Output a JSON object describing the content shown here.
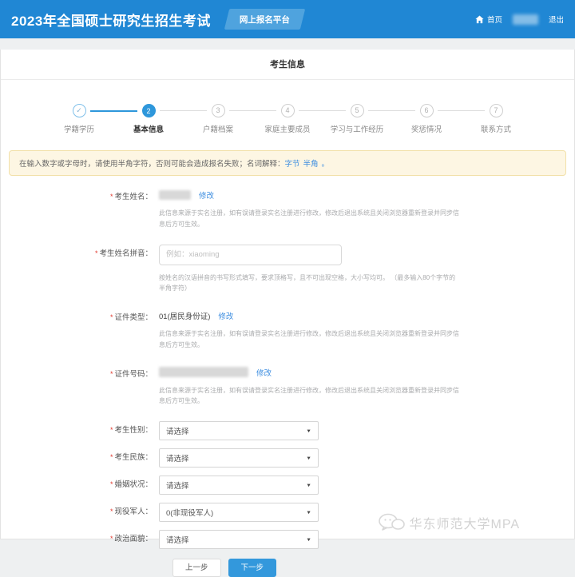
{
  "colors": {
    "header_blue": "#2087d4",
    "badge_blue": "#4fa3de",
    "accent_blue": "#2e97db",
    "link_blue": "#3e8ee0",
    "notice_bg": "#fdf6e3",
    "notice_border": "#f2e0a8",
    "required_red": "#e03a2f"
  },
  "header": {
    "title": "2023年全国硕士研究生招生考试",
    "badge": "网上报名平台",
    "home_label": "首页",
    "logout_label": "退出"
  },
  "page": {
    "title": "考生信息"
  },
  "steps": [
    {
      "num": "✓",
      "label": "学籍学历"
    },
    {
      "num": "2",
      "label": "基本信息"
    },
    {
      "num": "3",
      "label": "户籍档案"
    },
    {
      "num": "4",
      "label": "家庭主要成员"
    },
    {
      "num": "5",
      "label": "学习与工作经历"
    },
    {
      "num": "6",
      "label": "奖惩情况"
    },
    {
      "num": "7",
      "label": "联系方式"
    }
  ],
  "notice": {
    "prefix": "在输入数字或字母时，请使用半角字符，否则可能会造成报名失败；名词解释：",
    "link_byte": "字节",
    "link_halfwidth": "半角",
    "suffix": "。"
  },
  "form": {
    "required_mark": "*",
    "realname_help": "此信息来源于实名注册，如有误请登录实名注册进行修改，修改后退出系统且关闭浏览器重新登录并同步信息后方可生效。",
    "name": {
      "label": "考生姓名：",
      "edit": "修改"
    },
    "pinyin": {
      "label": "考生姓名拼音：",
      "value": "",
      "placeholder": "例如：xiaoming",
      "help": "按姓名的汉语拼音的书写形式填写，要求顶格写，且不可出现空格，大小写均可。 （最多输入80个字节的半角字符）"
    },
    "id_type": {
      "label": "证件类型：",
      "value": "01(居民身份证)",
      "edit": "修改"
    },
    "id_number": {
      "label": "证件号码：",
      "edit": "修改"
    },
    "gender": {
      "label": "考生性别：",
      "value": "请选择"
    },
    "ethnic": {
      "label": "考生民族：",
      "value": "请选择"
    },
    "marital": {
      "label": "婚姻状况：",
      "value": "请选择"
    },
    "military": {
      "label": "现役军人：",
      "value": "0(非现役军人)"
    },
    "political": {
      "label": "政治面貌：",
      "value": "请选择"
    }
  },
  "icons": {
    "select_arrow": "▼",
    "home": "home-glyph",
    "wechat": "wechat-bubbles"
  },
  "buttons": {
    "prev": "上一步",
    "next": "下一步"
  },
  "watermark": {
    "text": "华东师范大学MPA"
  }
}
